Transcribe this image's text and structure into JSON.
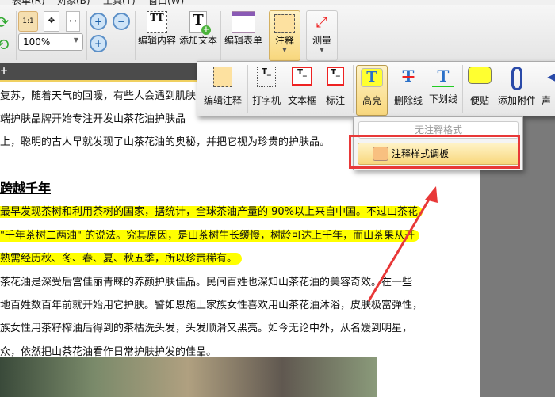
{
  "menu": [
    "表单(R)",
    "对象(B)",
    "工具(T)",
    "窗口(W)"
  ],
  "toolbar": {
    "zoom_value": "100%",
    "actual_size": "1:1",
    "edit_content": "编辑内容",
    "add_text": "添加文本",
    "edit_form": "编辑表单",
    "annotate": "注释",
    "measure": "测量"
  },
  "annot_panel": {
    "items": [
      "编辑注释",
      "打字机",
      "文本框",
      "标注",
      "高亮",
      "删除线",
      "下划线",
      "便贴",
      "添加附件",
      "声"
    ]
  },
  "dropdown": {
    "no_style": "无注释格式",
    "style_palette": "注释样式调板"
  },
  "document": {
    "lines_top": [
      "复苏，随着天气的回暖，有些人会遇到肌肤",
      "端护肤品牌开始专注开发山茶花油护肤品",
      "上，聪明的古人早就发现了山茶花油的奥秘，并把它视为珍贵的护肤品。"
    ],
    "heading": "跨越千年",
    "highlighted": [
      "最早发现茶树和利用茶树的国家，据统计，全球茶油产量的 90%以上来自中国。不过山茶花",
      "\"千年茶树二两油\" 的说法。究其原因，是山茶树生长缓慢，树龄可达上千年，而山茶果从开",
      "熟需经历秋、冬、春、夏、秋五季，所以珍贵稀有。"
    ],
    "lines_bottom": [
      "茶花油是深受后宫佳丽青睐的养颜护肤佳品。民间百姓也深知山茶花油的美容奇效。在一些",
      "地百姓数百年前就开始用它护肤。譬如恩施土家族女性喜欢用山茶花油沐浴，皮肤极富弹性，",
      "族女性用茶籽榨油后得到的茶枯洗头发，头发顺滑又黑亮。如今无论中外，从名媛到明星，",
      "众，依然把山茶花油看作日常护肤护发的佳品。"
    ]
  }
}
